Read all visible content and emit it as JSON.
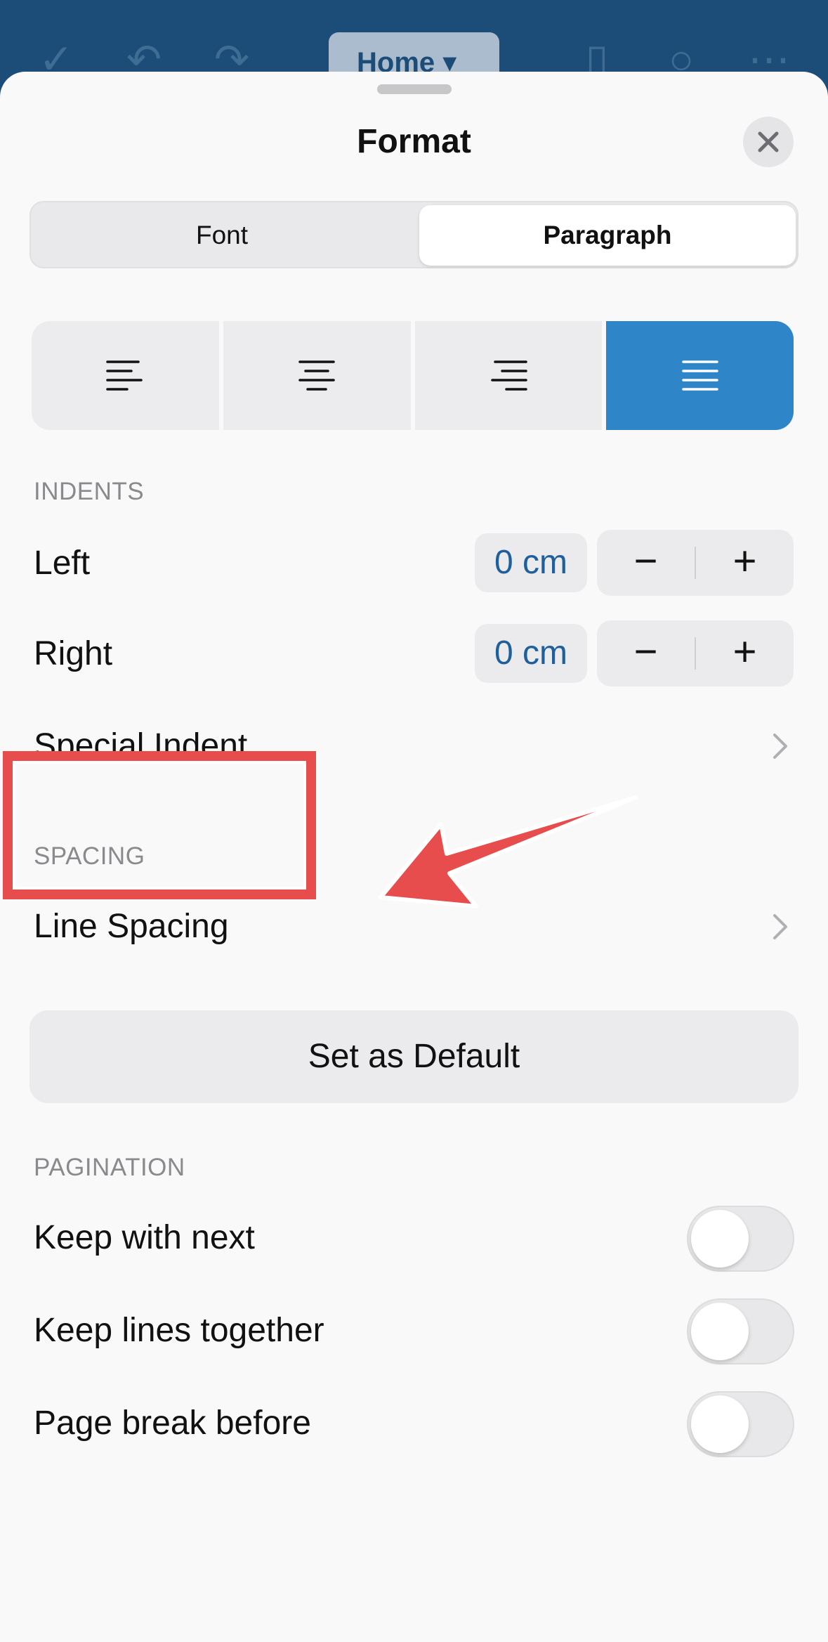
{
  "topbar": {
    "home_label": "Home"
  },
  "sheet": {
    "title": "Format",
    "tabs": [
      {
        "label": "Font",
        "selected": false
      },
      {
        "label": "Paragraph",
        "selected": true
      }
    ],
    "alignment": {
      "options": [
        "align-left",
        "align-center",
        "align-right",
        "justify"
      ],
      "selected": "justify"
    },
    "indents": {
      "section_label": "INDENTS",
      "left_label": "Left",
      "left_value": "0 cm",
      "right_label": "Right",
      "right_value": "0 cm",
      "special_label": "Special Indent"
    },
    "spacing": {
      "section_label": "SPACING",
      "line_spacing_label": "Line Spacing"
    },
    "default_button": "Set as Default",
    "pagination": {
      "section_label": "PAGINATION",
      "items": [
        {
          "label": "Keep with next",
          "on": false
        },
        {
          "label": "Keep lines together",
          "on": false
        },
        {
          "label": "Page break before",
          "on": false
        }
      ]
    }
  },
  "colors": {
    "accent": "#2e85c7",
    "value_text": "#1f5f9c",
    "annotation": "#e84d4d",
    "topbar": "#1b4d78"
  }
}
